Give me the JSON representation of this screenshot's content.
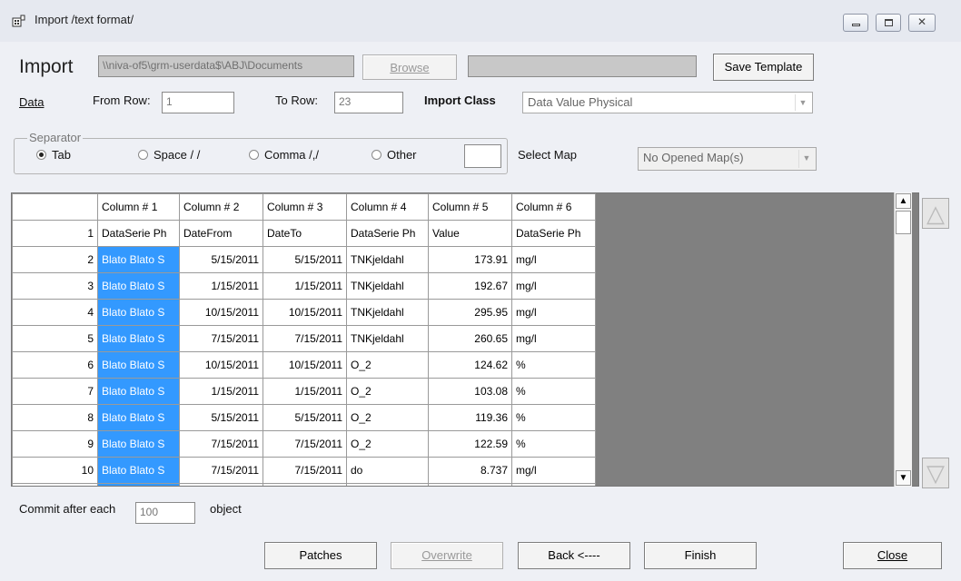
{
  "window": {
    "title": "Import /text format/"
  },
  "header": {
    "import_label": "Import",
    "path_value": "\\\\niva-of5\\grm-userdata$\\ABJ\\Documents",
    "browse_label": "Browse",
    "status_value": "",
    "save_template_label": "Save Template"
  },
  "rows": {
    "data_label": "Data",
    "from_row_label": "From Row:",
    "from_row_value": "1",
    "to_row_label": "To Row:",
    "to_row_value": "23",
    "import_class_label": "Import Class",
    "import_class_value": "Data Value Physical"
  },
  "separator": {
    "legend": "Separator",
    "options": [
      {
        "label": "Tab",
        "checked": true
      },
      {
        "label": "Space / /",
        "checked": false
      },
      {
        "label": "Comma /,/",
        "checked": false
      },
      {
        "label": "Other",
        "checked": false
      }
    ],
    "other_value": "",
    "select_map_label": "Select Map",
    "map_value": "No Opened Map(s)"
  },
  "grid": {
    "columns": [
      "Column # 1",
      "Column # 2",
      "Column # 3",
      "Column # 4",
      "Column # 5",
      "Column # 6"
    ],
    "rows": [
      [
        "1",
        "DataSerie Ph",
        "DateFrom",
        "DateTo",
        "DataSerie Ph",
        "Value",
        "DataSerie Ph"
      ],
      [
        "2",
        "Blato Blato S",
        "5/15/2011",
        "5/15/2011",
        "TNKjeldahl",
        "173.91",
        "mg/l"
      ],
      [
        "3",
        "Blato Blato S",
        "1/15/2011",
        "1/15/2011",
        "TNKjeldahl",
        "192.67",
        "mg/l"
      ],
      [
        "4",
        "Blato Blato S",
        "10/15/2011",
        "10/15/2011",
        "TNKjeldahl",
        "295.95",
        "mg/l"
      ],
      [
        "5",
        "Blato Blato S",
        "7/15/2011",
        "7/15/2011",
        "TNKjeldahl",
        "260.65",
        "mg/l"
      ],
      [
        "6",
        "Blato Blato S",
        "10/15/2011",
        "10/15/2011",
        "O_2",
        "124.62",
        "%"
      ],
      [
        "7",
        "Blato Blato S",
        "1/15/2011",
        "1/15/2011",
        "O_2",
        "103.08",
        "%"
      ],
      [
        "8",
        "Blato Blato S",
        "5/15/2011",
        "5/15/2011",
        "O_2",
        "119.36",
        "%"
      ],
      [
        "9",
        "Blato Blato S",
        "7/15/2011",
        "7/15/2011",
        "O_2",
        "122.59",
        "%"
      ],
      [
        "10",
        "Blato Blato S",
        "7/15/2011",
        "7/15/2011",
        "do",
        "8.737",
        "mg/l"
      ]
    ]
  },
  "commit": {
    "label": "Commit after each",
    "value": "100",
    "suffix": "object"
  },
  "buttons": {
    "patches": "Patches",
    "overwrite": "Overwrite",
    "back": "Back <----",
    "finish": "Finish",
    "close": "Close"
  },
  "colors": {
    "selection": "#3399ff",
    "grid_bg": "#808080"
  }
}
